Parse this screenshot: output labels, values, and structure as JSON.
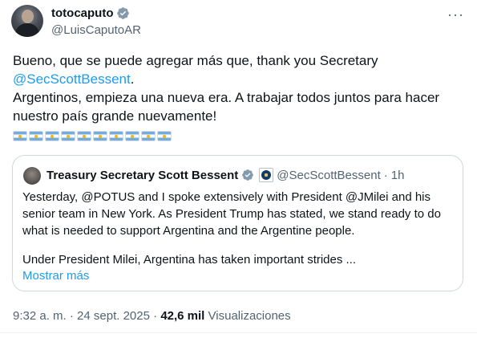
{
  "author": {
    "display_name": "totocaputo",
    "handle": "@LuisCaputoAR",
    "verified_icon": "verified-badge-icon",
    "verified_color": "#1d9bf0"
  },
  "more_icon": "more-options-icon",
  "tweet": {
    "line1": "Bueno, que se puede agregar más que, thank you Secretary",
    "mention": "@SecScottBessent",
    "line1_end": ".",
    "line2": "Argentinos, empieza una nueva era. A trabajar todos juntos para hacer nuestro país grande nuevamente!",
    "flag_emoji": "argentina-flag-icon",
    "flag_count": 10
  },
  "quoted": {
    "display_name": "Treasury Secretary Scott Bessent",
    "verified_icon": "verified-badge-icon",
    "affiliation_icon": "treasury-seal-icon",
    "handle": "@SecScottBessent",
    "dot": "·",
    "time": "1h",
    "para1": "Yesterday, @POTUS and I spoke extensively with President @JMilei and his senior team in New York.  As President Trump has stated, we stand ready to do what is needed to support Argentina and the Argentine people.",
    "para2": "Under President Milei, Argentina has taken important strides ...",
    "show_more": "Mostrar más"
  },
  "meta": {
    "time": "9:32 a. m.",
    "sep1": "·",
    "date": "24 sept. 2025",
    "sep2": "·",
    "views_count": "42,6 mil",
    "views_label": "Visualizaciones"
  },
  "colors": {
    "accent": "#1d9bf0",
    "secondary_text": "#536471",
    "primary_text": "#0f1419",
    "border": "#cfd9de"
  }
}
